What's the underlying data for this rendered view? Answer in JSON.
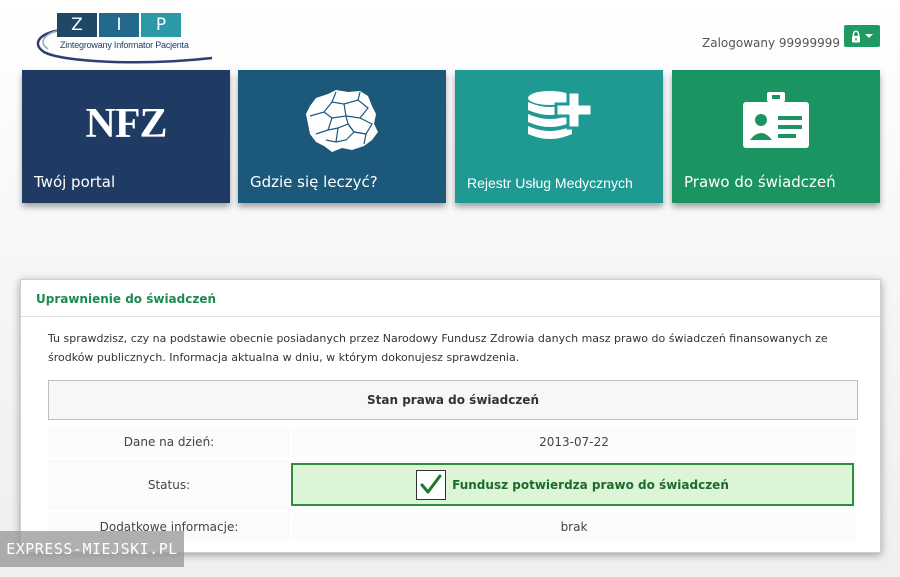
{
  "logo": {
    "letters": [
      "Z",
      "I",
      "P"
    ],
    "subtitle": "Zintegrowany Informator Pacjenta"
  },
  "user": {
    "label": "Zalogowany 99999999",
    "menu_icon": "lock-icon"
  },
  "tiles": [
    {
      "label": "Twój portal",
      "icon": "nfz-logo",
      "logo_text": "NFZ",
      "color": "#1f3b63"
    },
    {
      "label": "Gdzie się leczyć?",
      "icon": "poland-map-icon",
      "color": "#1c587a"
    },
    {
      "label": "Rejestr Usług Medycznych",
      "icon": "database-plus-icon",
      "color": "#1e9a93"
    },
    {
      "label": "Prawo do świadczeń",
      "icon": "id-card-icon",
      "color": "#1a9460"
    }
  ],
  "panel": {
    "title": "Uprawnienie do świadczeń",
    "description": "Tu sprawdzisz, czy na podstawie obecnie posiadanych przez Narodowy Fundusz Zdrowia danych masz prawo do świadczeń finansowanych ze środków publicznych. Informacja aktualna w dniu, w którym dokonujesz sprawdzenia.",
    "section_header": "Stan prawa do świadczeń",
    "rows": {
      "date_label": "Dane na dzień:",
      "date_value": "2013-07-22",
      "status_label": "Status:",
      "status_value": "Fundusz potwierdza prawo do świadczeń",
      "extra_label": "Dodatkowe informacje:",
      "extra_value": "brak"
    },
    "colors": {
      "title": "#1b8c4f",
      "status_bg": "#dcf5d8",
      "status_border": "#2e8c3c"
    }
  },
  "watermark": "EXPRESS-MIEJSKI.PL"
}
